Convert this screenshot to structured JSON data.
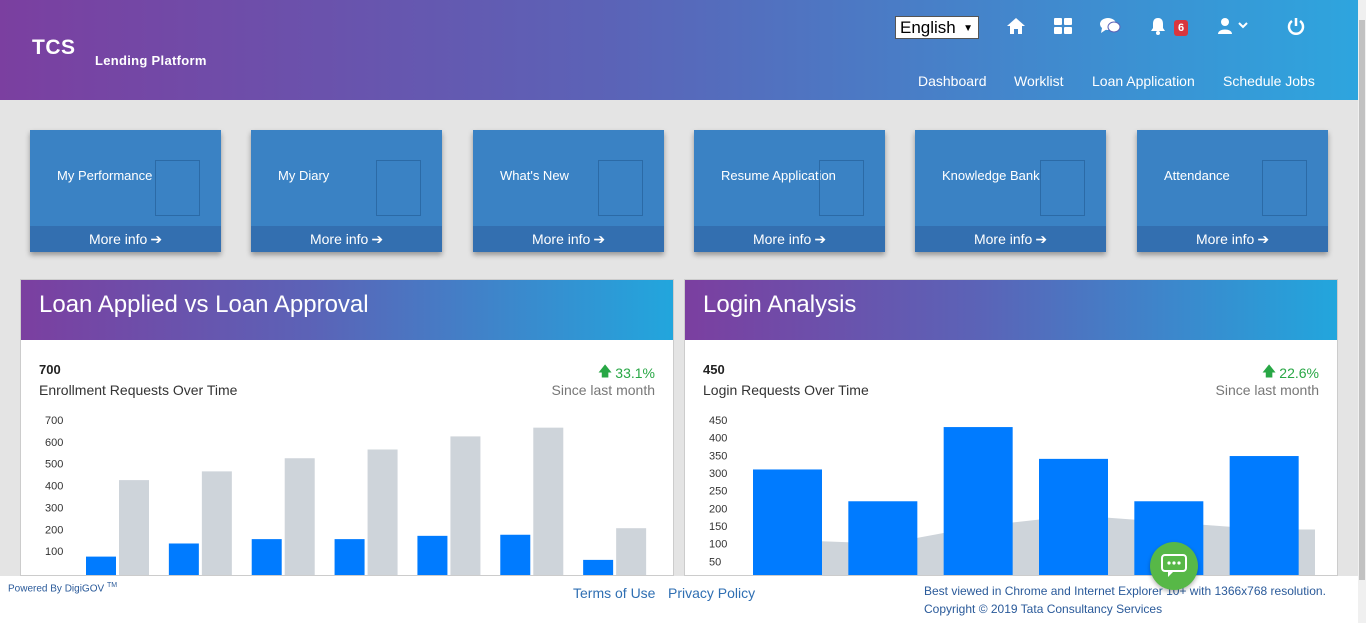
{
  "header": {
    "brand": "TCS",
    "brand_sub": "Lending Platform",
    "language": "English",
    "notifications_count": "6",
    "icons": [
      "home-icon",
      "dashboard-grid-icon",
      "chat-icon",
      "bell-icon",
      "user-icon",
      "power-icon"
    ],
    "nav": [
      "Dashboard",
      "Worklist",
      "Loan Application",
      "Schedule Jobs"
    ]
  },
  "tiles": [
    {
      "title": "My Performance",
      "more": "More info"
    },
    {
      "title": "My Diary",
      "more": "More info"
    },
    {
      "title": "What's New",
      "more": "More info"
    },
    {
      "title": "Resume Application",
      "more": "More info"
    },
    {
      "title": "Knowledge Bank",
      "more": "More info"
    },
    {
      "title": "Attendance",
      "more": "More info"
    }
  ],
  "panels": {
    "loan": {
      "title": "Loan Applied vs Loan Approval",
      "value": "700",
      "label": "Enrollment Requests Over Time",
      "pct": "33.1%",
      "since": "Since last month"
    },
    "login": {
      "title": "Login Analysis",
      "value": "450",
      "label": "Login Requests Over Time",
      "pct": "22.6%",
      "since": "Since last month"
    }
  },
  "chart_data": [
    {
      "type": "bar",
      "categories": [
        "",
        "",
        "",
        "",
        "",
        "",
        ""
      ],
      "series": [
        {
          "values": [
            75,
            135,
            155,
            155,
            170,
            175,
            60
          ]
        },
        {
          "values": [
            425,
            465,
            525,
            565,
            625,
            665,
            205
          ]
        }
      ],
      "yticks": [
        100,
        200,
        300,
        400,
        500,
        600,
        700
      ],
      "ylim": [
        0,
        700
      ],
      "colors": [
        "#007bff",
        "#ced4da"
      ]
    },
    {
      "type": "bar",
      "categories": [
        "",
        "",
        "",
        "",
        "",
        ""
      ],
      "series": [
        {
          "values": [
            310,
            220,
            430,
            340,
            220,
            348
          ]
        },
        {
          "type": "area",
          "values": [
            110,
            100,
            150,
            180,
            160,
            140
          ]
        }
      ],
      "yticks": [
        50,
        100,
        150,
        200,
        250,
        300,
        350,
        400,
        450
      ],
      "ylim": [
        0,
        450
      ],
      "colors": [
        "#007bff",
        "#ced4da"
      ]
    }
  ],
  "footer": {
    "powered": "Powered By DigiGOV",
    "tm": "TM",
    "terms": "Terms of Use",
    "privacy": "Privacy Policy",
    "best_viewed": "Best viewed in Chrome and Internet Explorer 10+ with 1366x768 resolution.",
    "copyright": "Copyright © 2019 Tata Consultancy Services"
  },
  "colors": {
    "primary_bar": "#007bff",
    "secondary_bar": "#ced4da",
    "tile": "#3a82c4",
    "up": "#28a745"
  }
}
